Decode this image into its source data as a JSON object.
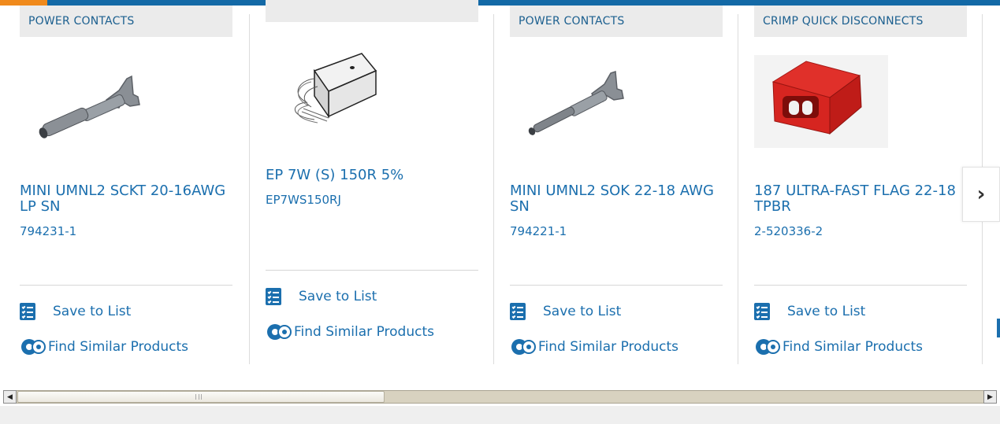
{
  "cards": [
    {
      "category": "POWER CONTACTS",
      "title": "MINI UMNL2 SCKT 20-16AWG LP SN",
      "part_number": "794231-1",
      "save_label": "Save to List",
      "similar_label": "Find Similar Products"
    },
    {
      "category": "",
      "title": "EP 7W (S) 150R 5%",
      "part_number": "EP7WS150RJ",
      "save_label": "Save to List",
      "similar_label": "Find Similar Products"
    },
    {
      "category": "POWER CONTACTS",
      "title": "MINI UMNL2 SOK 22-18 AWG SN",
      "part_number": "794221-1",
      "save_label": "Save to List",
      "similar_label": "Find Similar Products"
    },
    {
      "category": "CRIMP QUICK DISCONNECTS",
      "title": "187 ULTRA-FAST FLAG 22-18 TPBR",
      "part_number": "2-520336-2",
      "save_label": "Save to List",
      "similar_label": "Find Similar Products"
    }
  ],
  "carousel": {
    "next_icon": "chevron-right-icon",
    "next_glyph": "›"
  },
  "icons": {
    "save": "checklist-icon",
    "similar": "gears-icon"
  },
  "colors": {
    "accent": "#f08a1c",
    "brand": "#1369a6",
    "link": "#1b6fae",
    "label_bg": "#ebebeb"
  },
  "scrollbar": {
    "left_arrow": "◀",
    "right_arrow": "▶"
  }
}
